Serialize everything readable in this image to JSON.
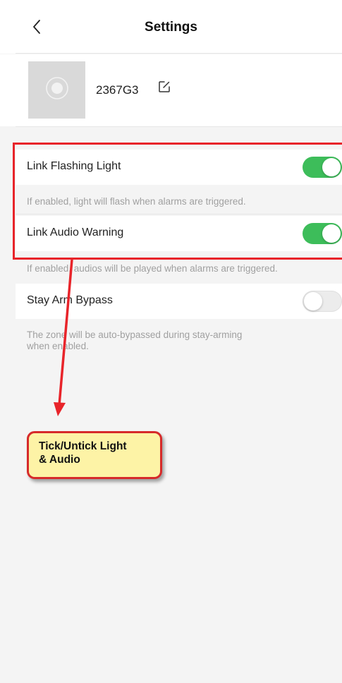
{
  "header": {
    "title": "Settings"
  },
  "device": {
    "name": "2367G3"
  },
  "settings": [
    {
      "label": "Link Flashing Light",
      "enabled": true,
      "description": "If enabled, light will flash when alarms are triggered."
    },
    {
      "label": "Link Audio Warning",
      "enabled": true,
      "description": "If enabled, audios will be played when alarms are triggered."
    },
    {
      "label": "Stay Arm Bypass",
      "enabled": false,
      "description_line1": "The zone will be auto-bypassed during stay-arming",
      "description_line2": "when enabled."
    }
  ],
  "annotation": {
    "callout_line1": "Tick/Untick Light",
    "callout_line2": "& Audio"
  },
  "colors": {
    "toggle_on": "#3dbd5a",
    "annotation_red": "#e8242a",
    "callout_fill": "#fdf3a6"
  }
}
